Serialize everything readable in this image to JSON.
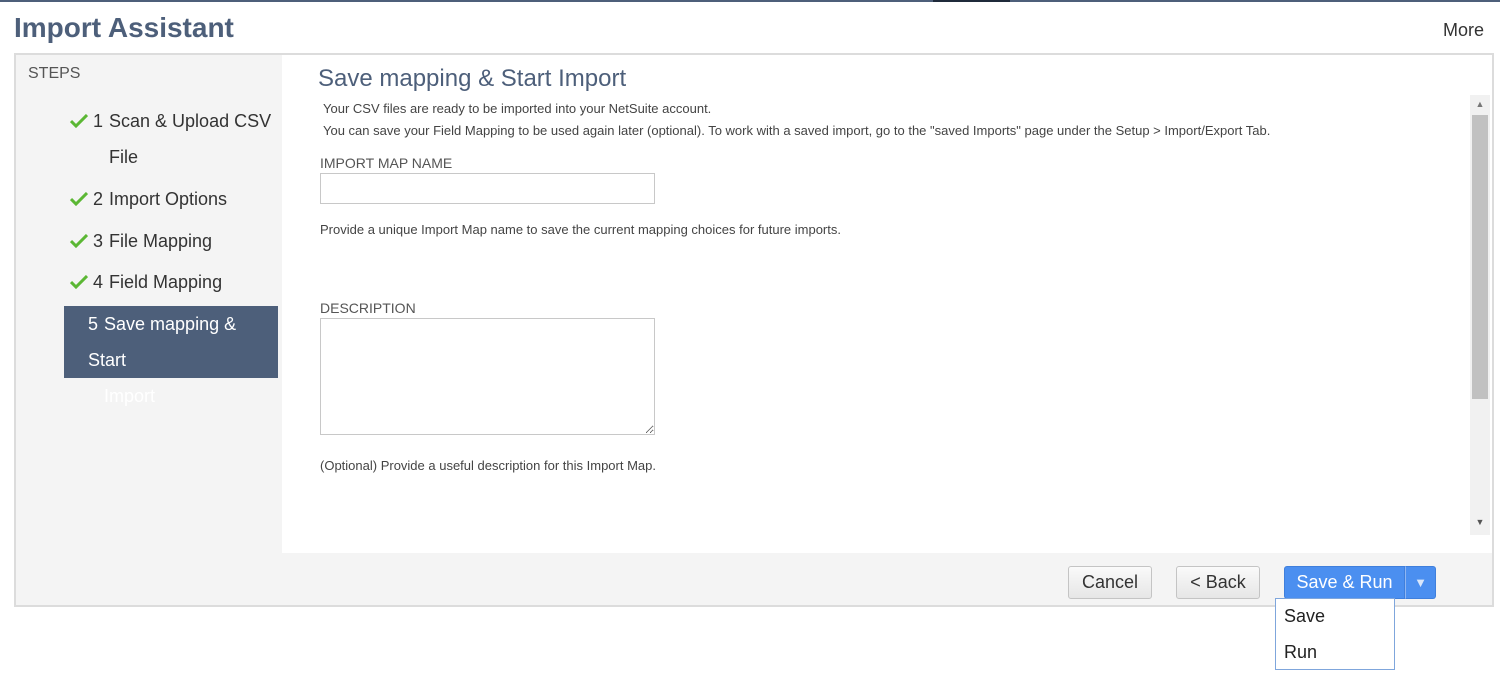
{
  "header": {
    "title": "Import Assistant",
    "more_label": "More"
  },
  "steps": {
    "title": "STEPS",
    "items": [
      {
        "num": "1",
        "line1": "Scan & Upload CSV",
        "line2": "File",
        "status": "complete"
      },
      {
        "num": "2",
        "line1": "Import Options",
        "line2": "",
        "status": "complete"
      },
      {
        "num": "3",
        "line1": "File Mapping",
        "line2": "",
        "status": "complete"
      },
      {
        "num": "4",
        "line1": "Field Mapping",
        "line2": "",
        "status": "complete"
      },
      {
        "num": "5",
        "line1": "Save mapping & Start",
        "line2": "Import",
        "status": "active"
      }
    ],
    "check_icon": "checkmark-icon",
    "check_color": "#5bb734",
    "active_color": "#4d5f7a"
  },
  "main": {
    "title": "Save mapping & Start Import",
    "intro_line1": "Your CSV files are ready to be imported into your NetSuite account.",
    "intro_line2": "You can save your Field Mapping to be used again later (optional). To work with a saved import, go to the \"saved Imports\" page under the Setup > Import/Export Tab.",
    "import_map_name": {
      "label": "IMPORT MAP NAME",
      "value": "",
      "help": "Provide a unique Import Map name to save the current mapping choices for future imports."
    },
    "description": {
      "label": "DESCRIPTION",
      "value": "",
      "help": "(Optional) Provide a useful description for this Import Map."
    }
  },
  "footer": {
    "cancel_label": "Cancel",
    "back_label": "< Back",
    "save_run_label": "Save & Run",
    "dropdown_arrow": "▼",
    "primary_color": "#4b8ff0"
  },
  "dropdown_menu": {
    "items": [
      "Save",
      "Run"
    ]
  }
}
